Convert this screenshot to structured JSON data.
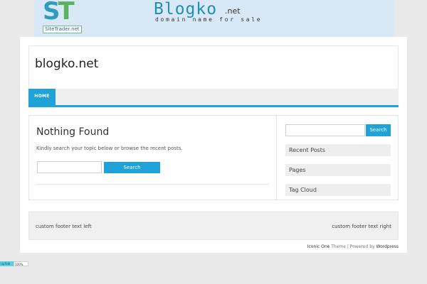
{
  "banner": {
    "logo_letters": "ST",
    "logo_tag": "SiteTrader.net",
    "domain_title": "Blogko",
    "domain_suffix": ".net",
    "tagline": "domain name for sale"
  },
  "header": {
    "site_title": "blogko.net"
  },
  "nav": {
    "items": [
      {
        "label": "HOME"
      }
    ]
  },
  "main": {
    "heading": "Nothing Found",
    "message": "Kindly search your topic below or browse the recent posts.",
    "search_value": "",
    "search_button": "Search"
  },
  "sidebar": {
    "search_value": "",
    "search_button": "Search",
    "widgets": [
      {
        "title": "Recent Posts"
      },
      {
        "title": "Pages"
      },
      {
        "title": "Tag Cloud"
      }
    ]
  },
  "footer": {
    "left": "custom footer text left",
    "right": "custom footer text right"
  },
  "credit": {
    "theme_name": "Iconic One",
    "theme_word": " Theme | Powered by ",
    "platform": "Wordpress"
  },
  "badge": {
    "left_text": "UpTodl",
    "right_text": "100%"
  },
  "colors": {
    "accent": "#1fa2d8",
    "banner_bg": "#d9e8f6",
    "page_bg": "#e9e9e9"
  }
}
